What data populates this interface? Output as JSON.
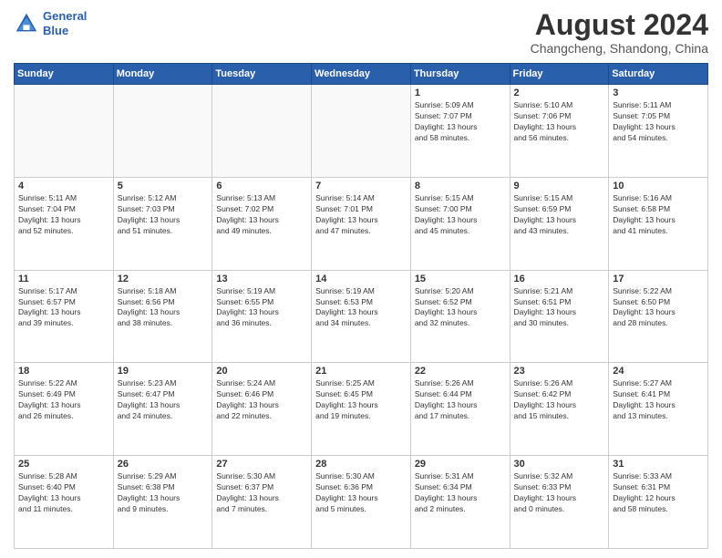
{
  "header": {
    "logo_line1": "General",
    "logo_line2": "Blue",
    "main_title": "August 2024",
    "subtitle": "Changcheng, Shandong, China"
  },
  "weekdays": [
    "Sunday",
    "Monday",
    "Tuesday",
    "Wednesday",
    "Thursday",
    "Friday",
    "Saturday"
  ],
  "weeks": [
    [
      {
        "day": "",
        "detail": ""
      },
      {
        "day": "",
        "detail": ""
      },
      {
        "day": "",
        "detail": ""
      },
      {
        "day": "",
        "detail": ""
      },
      {
        "day": "1",
        "detail": "Sunrise: 5:09 AM\nSunset: 7:07 PM\nDaylight: 13 hours\nand 58 minutes."
      },
      {
        "day": "2",
        "detail": "Sunrise: 5:10 AM\nSunset: 7:06 PM\nDaylight: 13 hours\nand 56 minutes."
      },
      {
        "day": "3",
        "detail": "Sunrise: 5:11 AM\nSunset: 7:05 PM\nDaylight: 13 hours\nand 54 minutes."
      }
    ],
    [
      {
        "day": "4",
        "detail": "Sunrise: 5:11 AM\nSunset: 7:04 PM\nDaylight: 13 hours\nand 52 minutes."
      },
      {
        "day": "5",
        "detail": "Sunrise: 5:12 AM\nSunset: 7:03 PM\nDaylight: 13 hours\nand 51 minutes."
      },
      {
        "day": "6",
        "detail": "Sunrise: 5:13 AM\nSunset: 7:02 PM\nDaylight: 13 hours\nand 49 minutes."
      },
      {
        "day": "7",
        "detail": "Sunrise: 5:14 AM\nSunset: 7:01 PM\nDaylight: 13 hours\nand 47 minutes."
      },
      {
        "day": "8",
        "detail": "Sunrise: 5:15 AM\nSunset: 7:00 PM\nDaylight: 13 hours\nand 45 minutes."
      },
      {
        "day": "9",
        "detail": "Sunrise: 5:15 AM\nSunset: 6:59 PM\nDaylight: 13 hours\nand 43 minutes."
      },
      {
        "day": "10",
        "detail": "Sunrise: 5:16 AM\nSunset: 6:58 PM\nDaylight: 13 hours\nand 41 minutes."
      }
    ],
    [
      {
        "day": "11",
        "detail": "Sunrise: 5:17 AM\nSunset: 6:57 PM\nDaylight: 13 hours\nand 39 minutes."
      },
      {
        "day": "12",
        "detail": "Sunrise: 5:18 AM\nSunset: 6:56 PM\nDaylight: 13 hours\nand 38 minutes."
      },
      {
        "day": "13",
        "detail": "Sunrise: 5:19 AM\nSunset: 6:55 PM\nDaylight: 13 hours\nand 36 minutes."
      },
      {
        "day": "14",
        "detail": "Sunrise: 5:19 AM\nSunset: 6:53 PM\nDaylight: 13 hours\nand 34 minutes."
      },
      {
        "day": "15",
        "detail": "Sunrise: 5:20 AM\nSunset: 6:52 PM\nDaylight: 13 hours\nand 32 minutes."
      },
      {
        "day": "16",
        "detail": "Sunrise: 5:21 AM\nSunset: 6:51 PM\nDaylight: 13 hours\nand 30 minutes."
      },
      {
        "day": "17",
        "detail": "Sunrise: 5:22 AM\nSunset: 6:50 PM\nDaylight: 13 hours\nand 28 minutes."
      }
    ],
    [
      {
        "day": "18",
        "detail": "Sunrise: 5:22 AM\nSunset: 6:49 PM\nDaylight: 13 hours\nand 26 minutes."
      },
      {
        "day": "19",
        "detail": "Sunrise: 5:23 AM\nSunset: 6:47 PM\nDaylight: 13 hours\nand 24 minutes."
      },
      {
        "day": "20",
        "detail": "Sunrise: 5:24 AM\nSunset: 6:46 PM\nDaylight: 13 hours\nand 22 minutes."
      },
      {
        "day": "21",
        "detail": "Sunrise: 5:25 AM\nSunset: 6:45 PM\nDaylight: 13 hours\nand 19 minutes."
      },
      {
        "day": "22",
        "detail": "Sunrise: 5:26 AM\nSunset: 6:44 PM\nDaylight: 13 hours\nand 17 minutes."
      },
      {
        "day": "23",
        "detail": "Sunrise: 5:26 AM\nSunset: 6:42 PM\nDaylight: 13 hours\nand 15 minutes."
      },
      {
        "day": "24",
        "detail": "Sunrise: 5:27 AM\nSunset: 6:41 PM\nDaylight: 13 hours\nand 13 minutes."
      }
    ],
    [
      {
        "day": "25",
        "detail": "Sunrise: 5:28 AM\nSunset: 6:40 PM\nDaylight: 13 hours\nand 11 minutes."
      },
      {
        "day": "26",
        "detail": "Sunrise: 5:29 AM\nSunset: 6:38 PM\nDaylight: 13 hours\nand 9 minutes."
      },
      {
        "day": "27",
        "detail": "Sunrise: 5:30 AM\nSunset: 6:37 PM\nDaylight: 13 hours\nand 7 minutes."
      },
      {
        "day": "28",
        "detail": "Sunrise: 5:30 AM\nSunset: 6:36 PM\nDaylight: 13 hours\nand 5 minutes."
      },
      {
        "day": "29",
        "detail": "Sunrise: 5:31 AM\nSunset: 6:34 PM\nDaylight: 13 hours\nand 2 minutes."
      },
      {
        "day": "30",
        "detail": "Sunrise: 5:32 AM\nSunset: 6:33 PM\nDaylight: 13 hours\nand 0 minutes."
      },
      {
        "day": "31",
        "detail": "Sunrise: 5:33 AM\nSunset: 6:31 PM\nDaylight: 12 hours\nand 58 minutes."
      }
    ]
  ]
}
